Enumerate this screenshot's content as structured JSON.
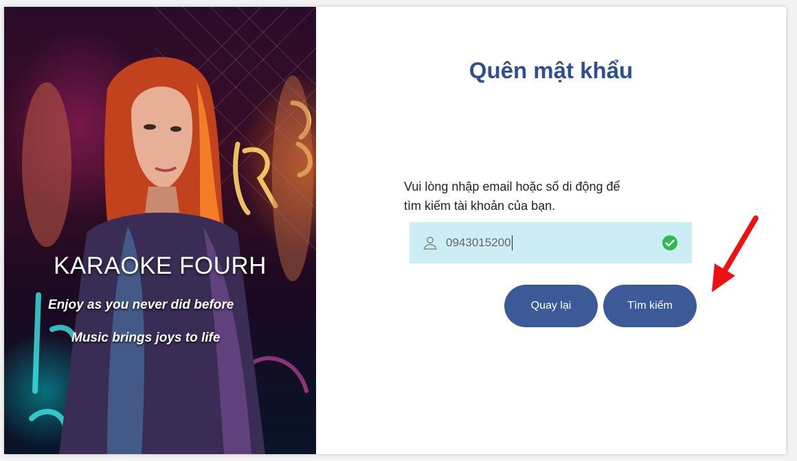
{
  "poster": {
    "title": "KARAOKE FOURH",
    "tagline1": "Enjoy as you never did before",
    "tagline2": "Music brings joys to life"
  },
  "form": {
    "heading": "Quên mật khẩu",
    "instructions_line1": "Vui lòng nhập email hoặc số di động để",
    "instructions_line2": "tìm kiếm tài khoản của bạn.",
    "input_value": "0943015200",
    "input_icon": "user-icon",
    "valid_icon": "check-circle-icon",
    "back_label": "Quay lại",
    "search_label": "Tìm kiếm"
  },
  "colors": {
    "heading": "#2f4f8f",
    "button": "#3c5a97",
    "input_bg": "#cdedf5",
    "valid_green": "#2dba4e",
    "annotation_arrow": "#ee1111"
  }
}
